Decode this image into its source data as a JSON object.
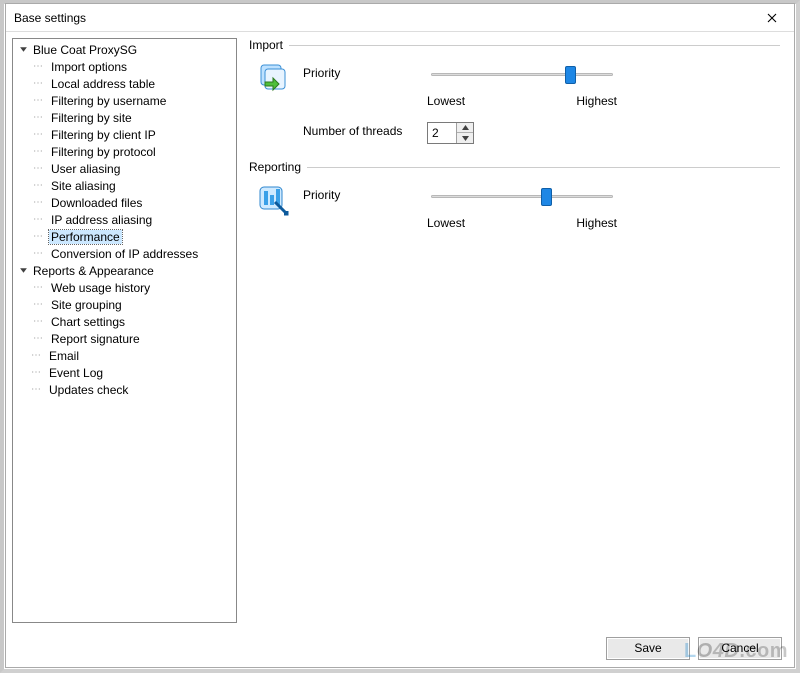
{
  "window": {
    "title": "Base settings"
  },
  "tree": {
    "root": {
      "label": "Blue Coat ProxySG",
      "children": [
        {
          "label": "Import options"
        },
        {
          "label": "Local address table"
        },
        {
          "label": "Filtering by username"
        },
        {
          "label": "Filtering by site"
        },
        {
          "label": "Filtering by client IP"
        },
        {
          "label": "Filtering by protocol"
        },
        {
          "label": "User aliasing"
        },
        {
          "label": "Site aliasing"
        },
        {
          "label": "Downloaded files"
        },
        {
          "label": "IP address aliasing"
        }
      ],
      "after": [
        {
          "label": "Performance",
          "selected": true
        },
        {
          "label": "Conversion of IP addresses"
        }
      ]
    },
    "group2": {
      "label": "Reports & Appearance",
      "children": [
        {
          "label": "Web usage history"
        },
        {
          "label": "Site grouping"
        },
        {
          "label": "Chart settings"
        },
        {
          "label": "Report signature"
        }
      ]
    },
    "tail": [
      {
        "label": "Email"
      },
      {
        "label": "Event Log"
      },
      {
        "label": "Updates check"
      }
    ]
  },
  "panel": {
    "import": {
      "title": "Import",
      "priority_label": "Priority",
      "lowest": "Lowest",
      "highest": "Highest",
      "threads_label": "Number of threads",
      "threads_value": "2"
    },
    "reporting": {
      "title": "Reporting",
      "priority_label": "Priority",
      "lowest": "Lowest",
      "highest": "Highest"
    }
  },
  "buttons": {
    "save": "Save",
    "cancel": "Cancel"
  },
  "watermark": "LO4D.com"
}
